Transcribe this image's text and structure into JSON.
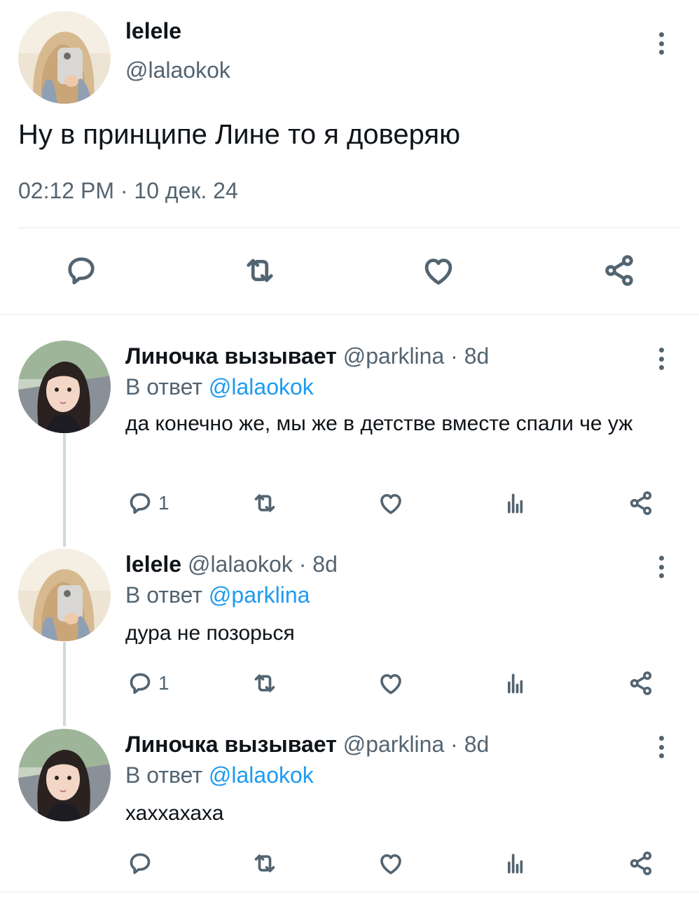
{
  "main_tweet": {
    "display_name": "lelele",
    "handle": "@lalaokok",
    "text": "Ну в принципе Лине то я доверяю",
    "time": "02:12 PM",
    "separator": " · ",
    "date": "10 дек. 24",
    "actions": [
      "reply-icon",
      "retweet-icon",
      "like-icon",
      "share-icon"
    ]
  },
  "replies": [
    {
      "display_name": "Линочка вызывает",
      "handle": "@parklina",
      "age": " · 8d",
      "reply_prefix": "В ответ ",
      "reply_to": "@lalaokok",
      "text": "да конечно же, мы же в детстве вместе спали че уж",
      "reply_count": "1"
    },
    {
      "display_name": "lelele",
      "handle": "@lalaokok",
      "age": " · 8d",
      "reply_prefix": "В ответ ",
      "reply_to": "@parklina",
      "text": "дура не позорься",
      "reply_count": "1"
    },
    {
      "display_name": "Линочка вызывает",
      "handle": "@parklina",
      "age": " · 8d",
      "reply_prefix": "В ответ ",
      "reply_to": "@lalaokok",
      "text": "хаххахаха",
      "reply_count": ""
    }
  ],
  "colors": {
    "text": "#0f1419",
    "secondary": "#536471",
    "link": "#1d9bf0",
    "divider": "#eff3f4",
    "thread_line": "#cfd9de"
  }
}
